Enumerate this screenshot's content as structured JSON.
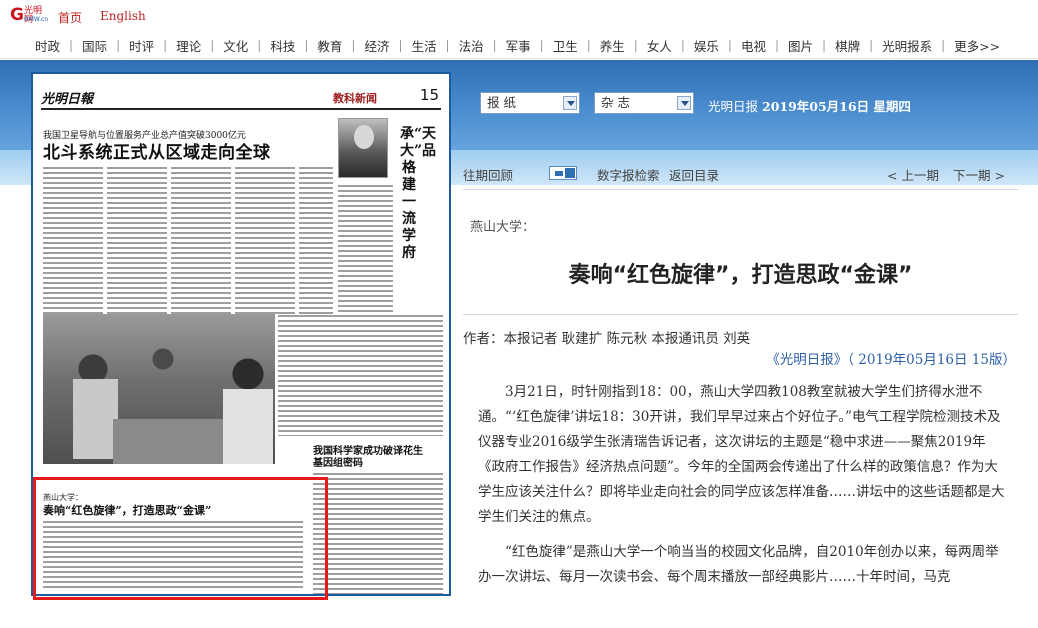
{
  "header": {
    "home_label": "首页",
    "english_label": "English"
  },
  "nav": {
    "items": [
      "时政",
      "国际",
      "时评",
      "理论",
      "文化",
      "科技",
      "教育",
      "经济",
      "生活",
      "法治",
      "军事",
      "卫生",
      "养生",
      "女人",
      "娱乐",
      "电视",
      "图片",
      "棋牌",
      "光明报系",
      "更多>>"
    ]
  },
  "paper": {
    "page_tag": "教科新闻",
    "page_number": "15",
    "story1_subtitle": "我国卫星导航与位置服务产业总产值突破3000亿元",
    "story1_title": "北斗系统正式从区域走向全球",
    "vertical_title": "承“天大”品格 建一流学府",
    "story2_title": "我国科学家成功破译花生基因组密码",
    "story3_kicker": "燕山大学：",
    "story3_title": "奏响“红色旋律”，打造思政“金课”"
  },
  "controls": {
    "select1": "报 纸",
    "select2": "杂 志",
    "date_prefix": "光明日报",
    "date_value": "2019年05月16日 星期四"
  },
  "toolbar": {
    "back_issue": "往期回顾",
    "search": "数字报检索",
    "return": "返回目录",
    "prev": "< 上一期",
    "next": "下一期 >"
  },
  "article": {
    "kicker": "燕山大学：",
    "title": "奏响“红色旋律”，打造思政“金课”",
    "author": "作者：本报记者 耿建扩 陈元秋 本报通讯员 刘英",
    "source": "《光明日报》（ 2019年05月16日 15版）",
    "para1": "3月21日，时针刚指到18：00，燕山大学四教108教室就被大学生们挤得水泄不通。“‘红色旋律’讲坛18：30开讲，我们早早过来占个好位子。”电气工程学院检测技术及仪器专业2016级学生张清瑞告诉记者，这次讲坛的主题是“稳中求进——聚焦2019年《政府工作报告》经济热点问题”。今年的全国两会传递出了什么样的政策信息？作为大学生应该关注什么？即将毕业走向社会的同学应该怎样准备……讲坛中的这些话题都是大学生们关注的焦点。",
    "para2": "“红色旋律”是燕山大学一个响当当的校园文化品牌，自2010年创办以来，每两周举办一次讲坛、每月一次读书会、每个周末播放一部经典影片……十年时间，马克"
  }
}
